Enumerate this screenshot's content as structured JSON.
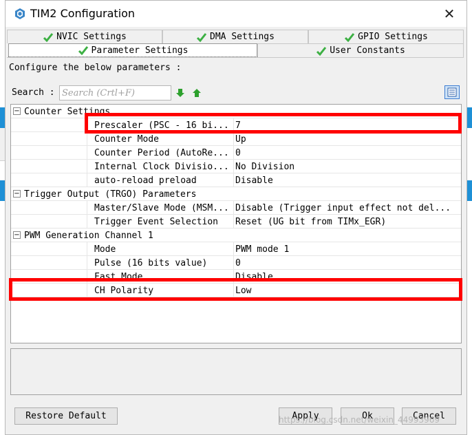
{
  "window": {
    "title": "TIM2 Configuration",
    "close_glyph": "✕",
    "icon": "cube-logo-icon"
  },
  "tabs": {
    "row1": [
      {
        "label": "NVIC Settings",
        "icon": "check-icon"
      },
      {
        "label": "DMA Settings",
        "icon": "check-icon"
      },
      {
        "label": "GPIO Settings",
        "icon": "check-icon"
      }
    ],
    "row2": [
      {
        "label": "Parameter Settings",
        "icon": "check-icon",
        "active": true
      },
      {
        "label": "User Constants",
        "icon": "check-icon"
      }
    ]
  },
  "configure_text": "Configure the below parameters :",
  "search": {
    "label": "Search :",
    "placeholder": "Search (Crtl+F)",
    "down_icon": "arrow-down-icon",
    "up_icon": "arrow-up-icon",
    "view_icon": "list-view-icon"
  },
  "tree": {
    "groups": [
      {
        "name": "Counter Settings",
        "params": [
          {
            "name": "Prescaler (PSC - 16 bi...",
            "value": "7"
          },
          {
            "name": "Counter Mode",
            "value": "Up"
          },
          {
            "name": "Counter Period (AutoRe...",
            "value": "0"
          },
          {
            "name": "Internal Clock Divisio...",
            "value": "No Division"
          },
          {
            "name": "auto-reload preload",
            "value": "Disable"
          }
        ]
      },
      {
        "name": "Trigger Output (TRGO) Parameters",
        "params": [
          {
            "name": "Master/Slave Mode (MSM...",
            "value": "Disable (Trigger input effect not del..."
          },
          {
            "name": "Trigger Event Selection",
            "value": "Reset (UG bit from TIMx_EGR)"
          }
        ]
      },
      {
        "name": "PWM Generation Channel 1",
        "params": [
          {
            "name": "Mode",
            "value": "PWM mode 1"
          },
          {
            "name": "Pulse (16 bits value)",
            "value": "0"
          },
          {
            "name": "Fast Mode",
            "value": "Disable"
          },
          {
            "name": "CH Polarity",
            "value": "Low"
          }
        ]
      }
    ],
    "expander_glyph": "−"
  },
  "buttons": {
    "restore": "Restore Default",
    "apply": "Apply",
    "ok": "Ok",
    "cancel": "Cancel"
  },
  "watermark": "https://blog.csdn.net/weixin_44993969",
  "colors": {
    "highlight": "#ff0000",
    "check_green": "#3cb043",
    "arrow_green": "#2ea12e",
    "background_blue": "#1e90d6"
  }
}
